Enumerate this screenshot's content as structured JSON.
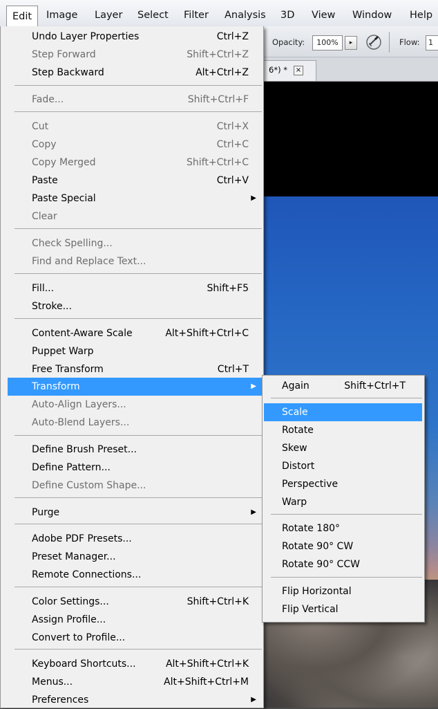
{
  "menubar": {
    "items": [
      "Edit",
      "Image",
      "Layer",
      "Select",
      "Filter",
      "Analysis",
      "3D",
      "View",
      "Window",
      "Help"
    ]
  },
  "options_bar": {
    "opacity_label": "Opacity:",
    "opacity_value": "100%",
    "arrow": "▸",
    "flow_label": "Flow:",
    "flow_value": "1"
  },
  "document_tab": {
    "title": "6*) *",
    "close": "×"
  },
  "edit_menu": {
    "items": [
      {
        "label": "Undo Layer Properties",
        "shortcut": "Ctrl+Z",
        "disabled": false
      },
      {
        "label": "Step Forward",
        "shortcut": "Shift+Ctrl+Z",
        "disabled": true
      },
      {
        "label": "Step Backward",
        "shortcut": "Alt+Ctrl+Z",
        "disabled": false
      },
      {
        "label": "Fade...",
        "shortcut": "Shift+Ctrl+F",
        "disabled": true
      },
      {
        "label": "Cut",
        "shortcut": "Ctrl+X",
        "disabled": true
      },
      {
        "label": "Copy",
        "shortcut": "Ctrl+C",
        "disabled": true
      },
      {
        "label": "Copy Merged",
        "shortcut": "Shift+Ctrl+C",
        "disabled": true
      },
      {
        "label": "Paste",
        "shortcut": "Ctrl+V",
        "disabled": false
      },
      {
        "label": "Paste Special",
        "shortcut": "",
        "disabled": false,
        "submenu": true
      },
      {
        "label": "Clear",
        "shortcut": "",
        "disabled": true
      },
      {
        "label": "Check Spelling...",
        "shortcut": "",
        "disabled": true
      },
      {
        "label": "Find and Replace Text...",
        "shortcut": "",
        "disabled": true
      },
      {
        "label": "Fill...",
        "shortcut": "Shift+F5",
        "disabled": false
      },
      {
        "label": "Stroke...",
        "shortcut": "",
        "disabled": false
      },
      {
        "label": "Content-Aware Scale",
        "shortcut": "Alt+Shift+Ctrl+C",
        "disabled": false
      },
      {
        "label": "Puppet Warp",
        "shortcut": "",
        "disabled": false
      },
      {
        "label": "Free Transform",
        "shortcut": "Ctrl+T",
        "disabled": false
      },
      {
        "label": "Transform",
        "shortcut": "",
        "disabled": false,
        "submenu": true,
        "highlighted": true
      },
      {
        "label": "Auto-Align Layers...",
        "shortcut": "",
        "disabled": true
      },
      {
        "label": "Auto-Blend Layers...",
        "shortcut": "",
        "disabled": true
      },
      {
        "label": "Define Brush Preset...",
        "shortcut": "",
        "disabled": false
      },
      {
        "label": "Define Pattern...",
        "shortcut": "",
        "disabled": false
      },
      {
        "label": "Define Custom Shape...",
        "shortcut": "",
        "disabled": true
      },
      {
        "label": "Purge",
        "shortcut": "",
        "disabled": false,
        "submenu": true
      },
      {
        "label": "Adobe PDF Presets...",
        "shortcut": "",
        "disabled": false
      },
      {
        "label": "Preset Manager...",
        "shortcut": "",
        "disabled": false
      },
      {
        "label": "Remote Connections...",
        "shortcut": "",
        "disabled": false
      },
      {
        "label": "Color Settings...",
        "shortcut": "Shift+Ctrl+K",
        "disabled": false
      },
      {
        "label": "Assign Profile...",
        "shortcut": "",
        "disabled": false
      },
      {
        "label": "Convert to Profile...",
        "shortcut": "",
        "disabled": false
      },
      {
        "label": "Keyboard Shortcuts...",
        "shortcut": "Alt+Shift+Ctrl+K",
        "disabled": false
      },
      {
        "label": "Menus...",
        "shortcut": "Alt+Shift+Ctrl+M",
        "disabled": false
      },
      {
        "label": "Preferences",
        "shortcut": "",
        "disabled": false,
        "submenu": true
      }
    ]
  },
  "transform_menu": {
    "items": [
      {
        "label": "Again",
        "shortcut": "Shift+Ctrl+T",
        "disabled": false
      },
      {
        "label": "Scale",
        "shortcut": "",
        "disabled": false,
        "highlighted": true
      },
      {
        "label": "Rotate",
        "shortcut": "",
        "disabled": false
      },
      {
        "label": "Skew",
        "shortcut": "",
        "disabled": false
      },
      {
        "label": "Distort",
        "shortcut": "",
        "disabled": false
      },
      {
        "label": "Perspective",
        "shortcut": "",
        "disabled": false
      },
      {
        "label": "Warp",
        "shortcut": "",
        "disabled": false
      },
      {
        "label": "Rotate 180°",
        "shortcut": "",
        "disabled": false
      },
      {
        "label": "Rotate 90° CW",
        "shortcut": "",
        "disabled": false
      },
      {
        "label": "Rotate 90° CCW",
        "shortcut": "",
        "disabled": false
      },
      {
        "label": "Flip Horizontal",
        "shortcut": "",
        "disabled": false
      },
      {
        "label": "Flip Vertical",
        "shortcut": "",
        "disabled": false
      }
    ]
  },
  "colors": {
    "highlight": "#3399ff",
    "menu_bg": "#f0f0f0",
    "disabled_text": "#6d6d6d"
  }
}
